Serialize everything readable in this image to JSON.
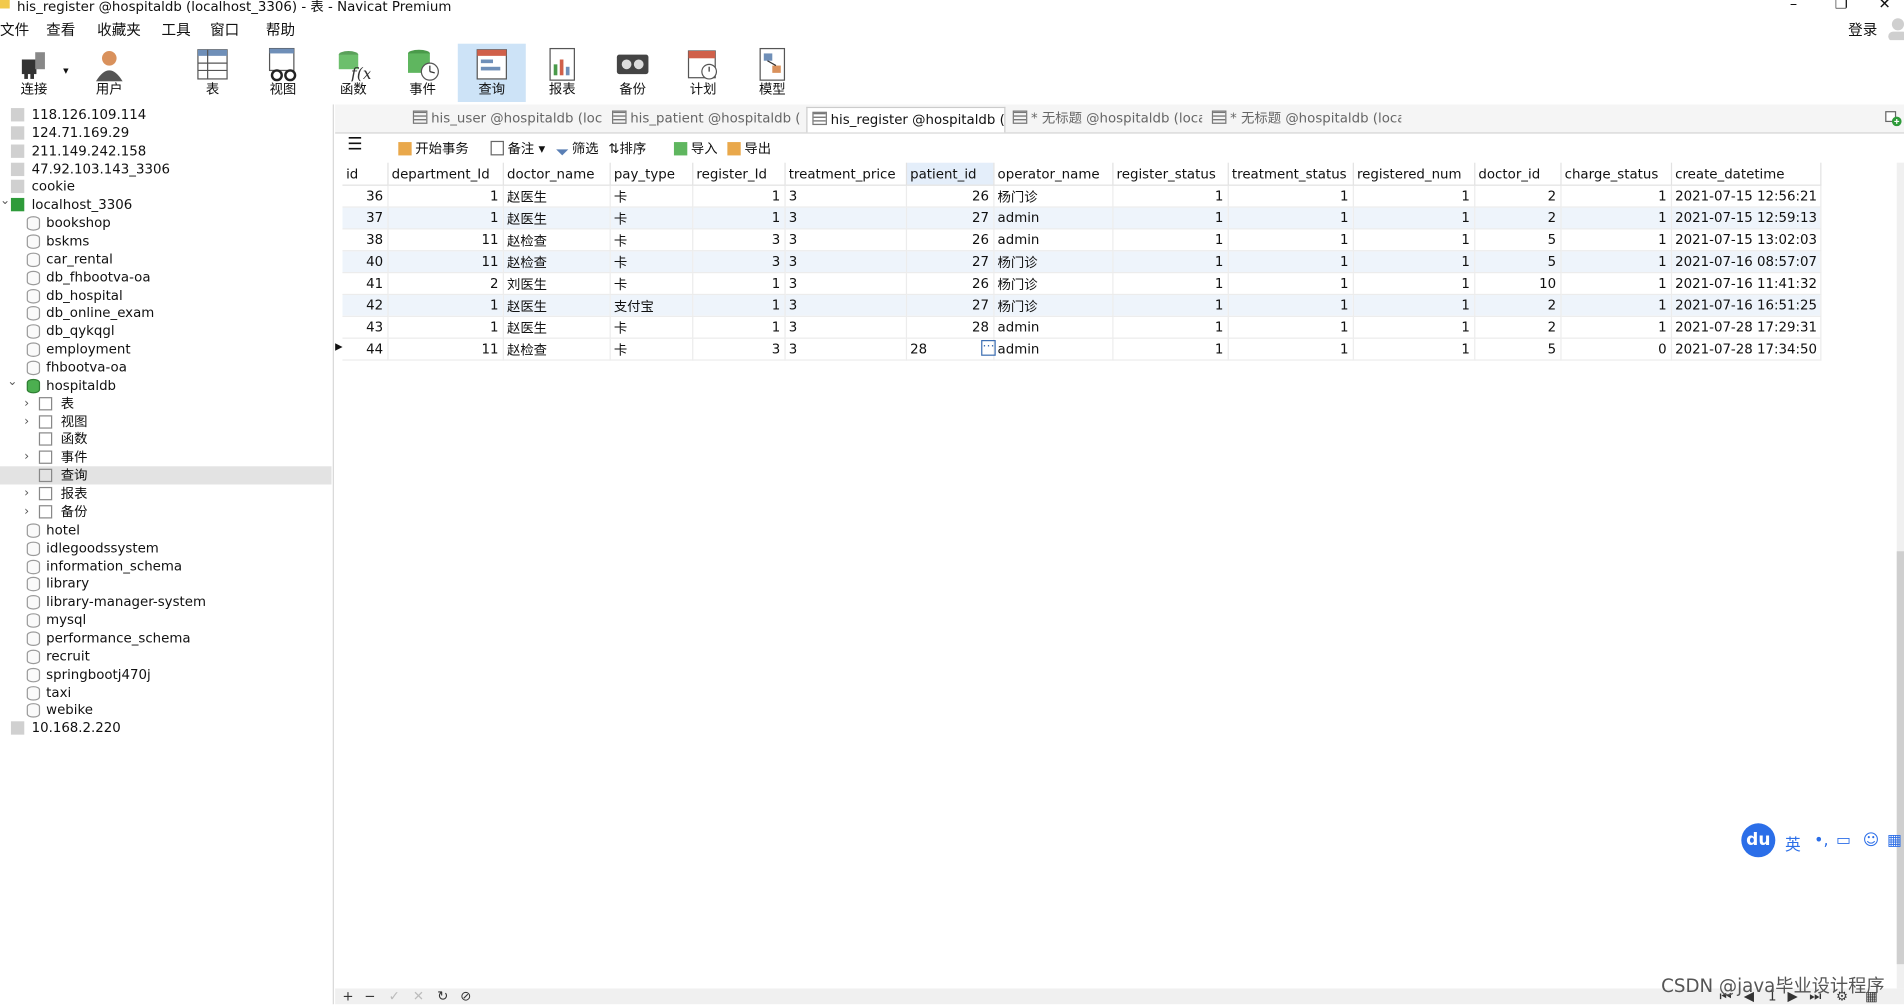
{
  "window": {
    "title": "his_register @hospitaldb (localhost_3306) - 表 - Navicat Premium"
  },
  "menu": [
    "文件",
    "查看",
    "收藏夹",
    "工具",
    "窗口",
    "帮助"
  ],
  "login_label": "登录",
  "toolbar": [
    {
      "label": "连接",
      "icon": "plug-icon"
    },
    {
      "label": "用户",
      "icon": "user-icon"
    },
    {
      "label": "表",
      "icon": "table-icon"
    },
    {
      "label": "视图",
      "icon": "view-icon"
    },
    {
      "label": "函数",
      "icon": "function-icon"
    },
    {
      "label": "事件",
      "icon": "event-icon"
    },
    {
      "label": "查询",
      "icon": "query-icon"
    },
    {
      "label": "报表",
      "icon": "report-icon"
    },
    {
      "label": "备份",
      "icon": "backup-icon"
    },
    {
      "label": "计划",
      "icon": "schedule-icon"
    },
    {
      "label": "模型",
      "icon": "model-icon"
    }
  ],
  "sidebar": {
    "nodes": [
      {
        "label": "118.126.109.114",
        "kind": "conn"
      },
      {
        "label": "124.71.169.29",
        "kind": "conn"
      },
      {
        "label": "211.149.242.158",
        "kind": "conn"
      },
      {
        "label": "47.92.103.143_3306",
        "kind": "conn"
      },
      {
        "label": "cookie",
        "kind": "conn"
      },
      {
        "label": "localhost_3306",
        "kind": "conn-on"
      },
      {
        "label": "bookshop",
        "kind": "db"
      },
      {
        "label": "bskms",
        "kind": "db"
      },
      {
        "label": "car_rental",
        "kind": "db"
      },
      {
        "label": "db_fhbootva-oa",
        "kind": "db"
      },
      {
        "label": "db_hospital",
        "kind": "db"
      },
      {
        "label": "db_online_exam",
        "kind": "db"
      },
      {
        "label": "db_qykqgl",
        "kind": "db"
      },
      {
        "label": "employment",
        "kind": "db"
      },
      {
        "label": "fhbootva-oa",
        "kind": "db"
      },
      {
        "label": "hospitaldb",
        "kind": "db-on"
      },
      {
        "label": "表",
        "kind": "child"
      },
      {
        "label": "视图",
        "kind": "child"
      },
      {
        "label": "函数",
        "kind": "child"
      },
      {
        "label": "事件",
        "kind": "child"
      },
      {
        "label": "查询",
        "kind": "child-sel"
      },
      {
        "label": "报表",
        "kind": "child"
      },
      {
        "label": "备份",
        "kind": "child"
      },
      {
        "label": "hotel",
        "kind": "db"
      },
      {
        "label": "idlegoodssystem",
        "kind": "db"
      },
      {
        "label": "information_schema",
        "kind": "db"
      },
      {
        "label": "library",
        "kind": "db"
      },
      {
        "label": "library-manager-system",
        "kind": "db"
      },
      {
        "label": "mysql",
        "kind": "db"
      },
      {
        "label": "performance_schema",
        "kind": "db"
      },
      {
        "label": "recruit",
        "kind": "db"
      },
      {
        "label": "springbootj470j",
        "kind": "db"
      },
      {
        "label": "taxi",
        "kind": "db"
      },
      {
        "label": "webike",
        "kind": "db"
      },
      {
        "label": "10.168.2.220",
        "kind": "conn"
      }
    ]
  },
  "tabs": [
    {
      "label": "his_user @hospitaldb (local..."
    },
    {
      "label": "his_patient @hospitaldb (lo..."
    },
    {
      "label": "his_register @hospitaldb (lo..."
    },
    {
      "label": "* 无标题 @hospitaldb (local..."
    },
    {
      "label": "* 无标题 @hospitaldb (local..."
    }
  ],
  "data_toolbar": {
    "begin_tx": "开始事务",
    "note": "备注",
    "filter": "筛选",
    "sort": "排序",
    "import": "导入",
    "export": "导出"
  },
  "grid": {
    "columns": [
      "id",
      "department_Id",
      "doctor_name",
      "pay_type",
      "register_Id",
      "treatment_price",
      "patient_id",
      "operator_name",
      "register_status",
      "treatment_status",
      "registered_num",
      "doctor_id",
      "charge_status",
      "create_datetime"
    ],
    "rows": [
      [
        "36",
        "1",
        "赵医生",
        "卡",
        "1",
        "3",
        "26",
        "杨门诊",
        "1",
        "1",
        "1",
        "2",
        "1",
        "2021-07-15 12:56:21"
      ],
      [
        "37",
        "1",
        "赵医生",
        "卡",
        "1",
        "3",
        "27",
        "admin",
        "1",
        "1",
        "1",
        "2",
        "1",
        "2021-07-15 12:59:13"
      ],
      [
        "38",
        "11",
        "赵检查",
        "卡",
        "3",
        "3",
        "26",
        "admin",
        "1",
        "1",
        "1",
        "5",
        "1",
        "2021-07-15 13:02:03"
      ],
      [
        "40",
        "11",
        "赵检查",
        "卡",
        "3",
        "3",
        "27",
        "杨门诊",
        "1",
        "1",
        "1",
        "5",
        "1",
        "2021-07-16 08:57:07"
      ],
      [
        "41",
        "2",
        "刘医生",
        "卡",
        "1",
        "3",
        "26",
        "杨门诊",
        "1",
        "1",
        "1",
        "10",
        "1",
        "2021-07-16 11:41:32"
      ],
      [
        "42",
        "1",
        "赵医生",
        "支付宝",
        "1",
        "3",
        "27",
        "杨门诊",
        "1",
        "1",
        "1",
        "2",
        "1",
        "2021-07-16 16:51:25"
      ],
      [
        "43",
        "1",
        "赵医生",
        "卡",
        "1",
        "3",
        "28",
        "admin",
        "1",
        "1",
        "1",
        "2",
        "1",
        "2021-07-28 17:29:31"
      ],
      [
        "44",
        "11",
        "赵检查",
        "卡",
        "3",
        "3",
        "28",
        "admin",
        "1",
        "1",
        "1",
        "5",
        "0",
        "2021-07-28 17:34:50"
      ]
    ]
  },
  "status": {
    "page": "1"
  },
  "ime": {
    "logo": "du",
    "mode": "英"
  },
  "watermark": "CSDN @java毕业设计程序"
}
